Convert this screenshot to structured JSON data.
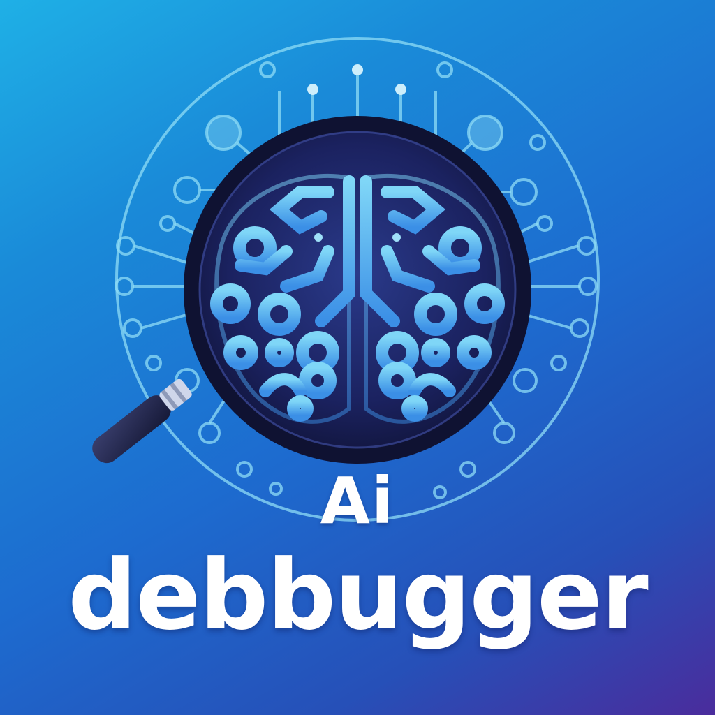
{
  "logo": {
    "title_line1": "Ai",
    "title_line2": "debbugger",
    "icons": [
      "magnifying-glass-icon",
      "brain-icon",
      "circuit-ring-icon"
    ],
    "colors": {
      "background_start": "#1fb0e6",
      "background_end": "#4a2c9c",
      "circuit": "#8fdcf5",
      "brain": "#6ec9f5",
      "lens_dark": "#1b1f4d",
      "text": "#ffffff"
    }
  }
}
